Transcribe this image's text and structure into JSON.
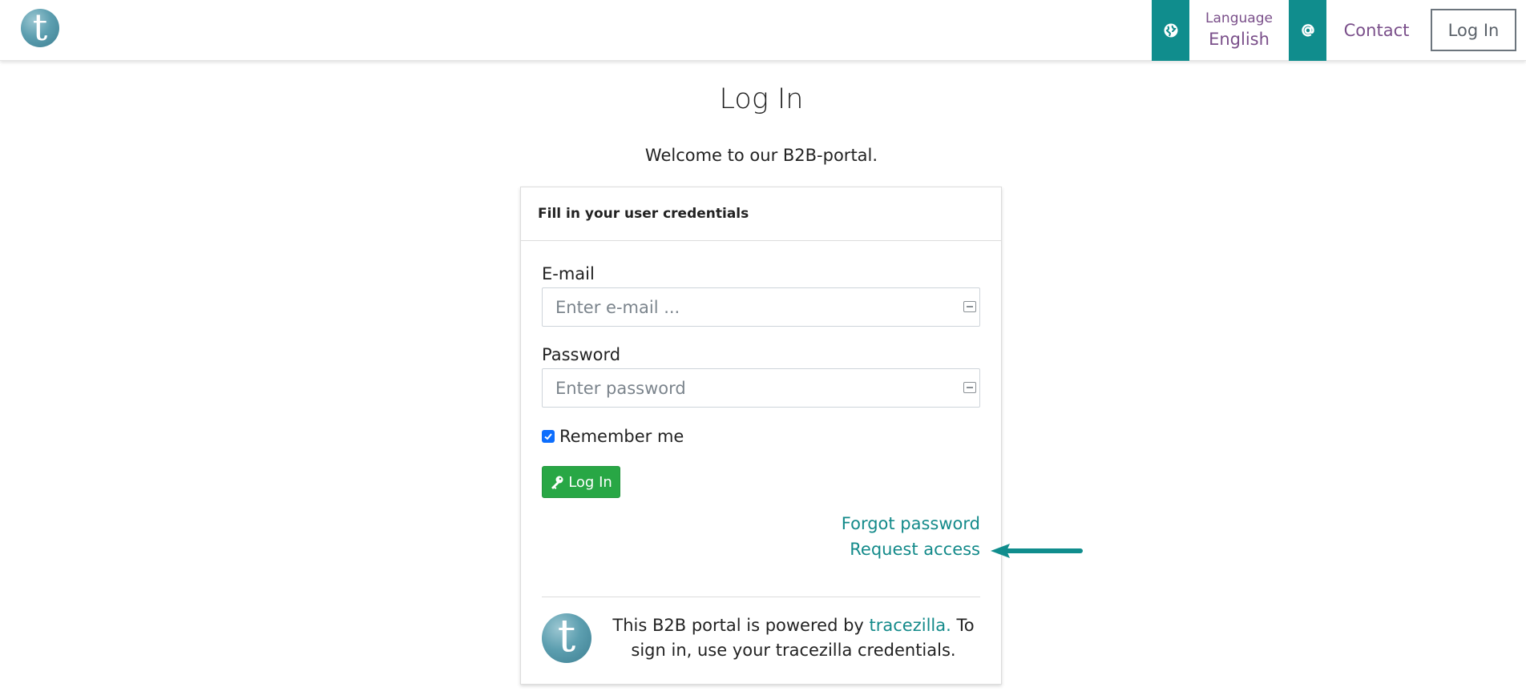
{
  "header": {
    "logo_letter": "t",
    "language_label": "Language",
    "language_value": "English",
    "contact_label": "Contact",
    "login_label": "Log In",
    "accent_color": "#108d8d"
  },
  "page": {
    "title": "Log In",
    "welcome": "Welcome to our B2B-portal."
  },
  "card": {
    "header": "Fill in your user credentials",
    "email_label": "E-mail",
    "email_placeholder": "Enter e-mail ...",
    "email_value": "",
    "password_label": "Password",
    "password_placeholder": "Enter password",
    "password_value": "",
    "remember_label": "Remember me",
    "remember_checked": true,
    "login_button": "Log In",
    "forgot_link": "Forgot password",
    "request_link": "Request access",
    "footer_prefix": "This B2B portal is powered by ",
    "footer_brand": "tracezilla.",
    "footer_suffix": " To sign in, use your tracezilla credentials.",
    "footer_logo_letter": "t",
    "success_color": "#28a745",
    "link_color": "#138a8a"
  },
  "icons": {
    "language": "globe-icon",
    "contact": "at-sign-icon",
    "login_button": "key-icon",
    "annotation": "arrow-left-icon"
  }
}
